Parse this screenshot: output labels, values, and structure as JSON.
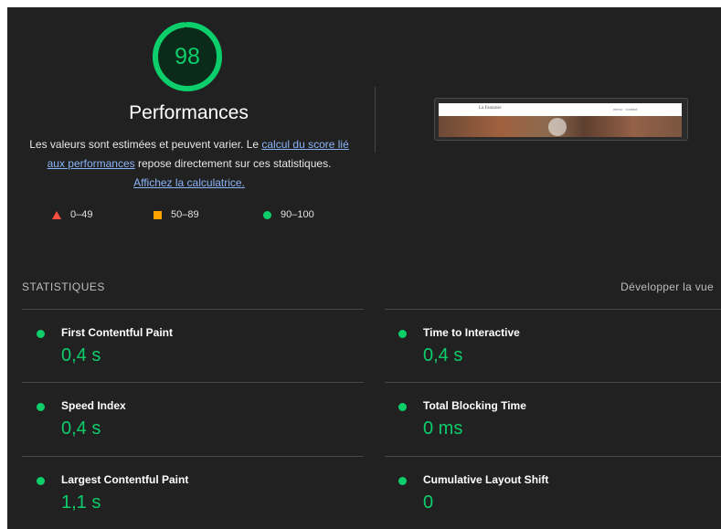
{
  "score": {
    "value": "98",
    "fraction": 0.98,
    "color": "#0cce6b"
  },
  "title": "Performances",
  "description": {
    "text1": "Les valeurs sont estimées et peuvent varier. Le ",
    "link1": "calcul du score lié aux performances",
    "text2": " repose directement sur ces statistiques. ",
    "link2": "Affichez la calculatrice."
  },
  "legend": [
    {
      "range": "0–49",
      "shape": "triangle",
      "color": "#ff4e42"
    },
    {
      "range": "50–89",
      "shape": "square",
      "color": "#ffa400"
    },
    {
      "range": "90–100",
      "shape": "circle",
      "color": "#0cce6b"
    }
  ],
  "thumbnail": {
    "brand": "La Fantaisie",
    "nav": "menu · contact"
  },
  "metrics_section": {
    "label": "STATISTIQUES",
    "expand_label": "Développer la vue"
  },
  "metrics": [
    {
      "name": "First Contentful Paint",
      "value": "0,4 s"
    },
    {
      "name": "Time to Interactive",
      "value": "0,4 s"
    },
    {
      "name": "Speed Index",
      "value": "0,4 s"
    },
    {
      "name": "Total Blocking Time",
      "value": "0 ms"
    },
    {
      "name": "Largest Contentful Paint",
      "value": "1,1 s"
    },
    {
      "name": "Cumulative Layout Shift",
      "value": "0"
    }
  ]
}
